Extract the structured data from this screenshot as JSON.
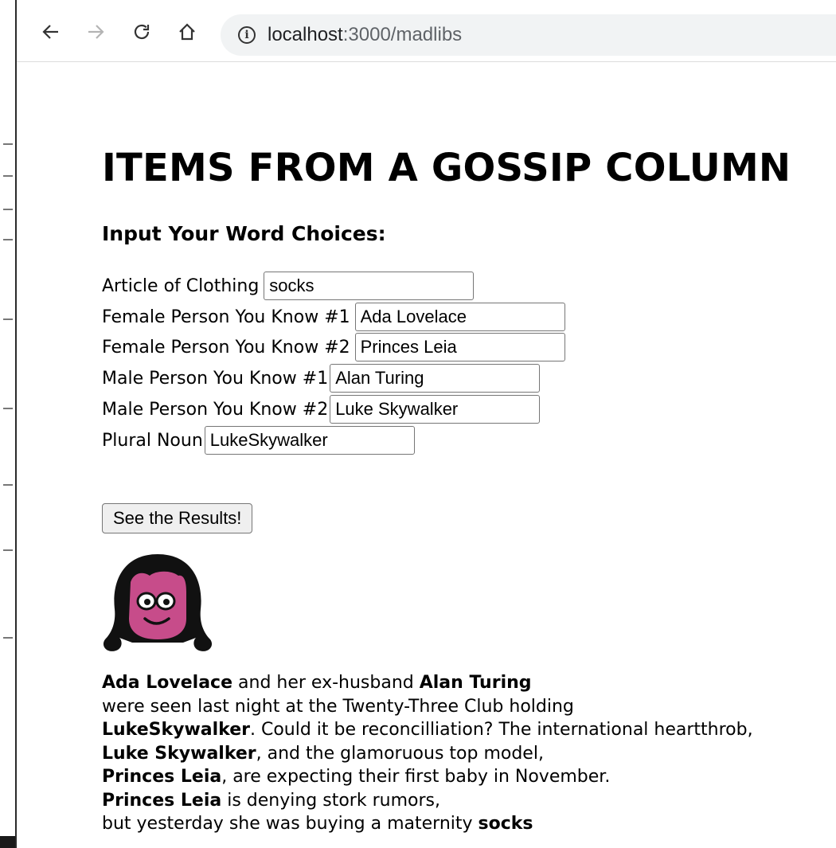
{
  "browser": {
    "url_host": "localhost",
    "url_path": ":3000/madlibs"
  },
  "page": {
    "title": "ITEMS FROM A GOSSIP COLUMN",
    "subtitle": "Input Your Word Choices:"
  },
  "form": {
    "fields": [
      {
        "label": "Article of Clothing",
        "value": "socks"
      },
      {
        "label": "Female Person You Know #1",
        "value": "Ada Lovelace"
      },
      {
        "label": "Female Person You Know #2",
        "value": "Princes Leia"
      },
      {
        "label": "Male Person You Know #1",
        "value": "Alan Turing"
      },
      {
        "label": "Male Person You Know #2",
        "value": "Luke Skywalker"
      },
      {
        "label": "Plural Noun",
        "value": "LukeSkywalker"
      }
    ],
    "submit_label": "See the Results!"
  },
  "avatar": {
    "icon": "cartoon-woman-avatar",
    "face_color": "#c74c8a",
    "hair_color": "#111111"
  },
  "result": {
    "female1": "Ada Lovelace",
    "t1": " and her ex-husband ",
    "male1": "Alan Turing",
    "t2": "were seen last night at the Twenty-Three Club holding",
    "plural_noun": "LukeSkywalker",
    "t3": ". Could it be reconcilliation? The international heartthrob,",
    "male2": "Luke Skywalker",
    "t4": ", and the glamoruous top model,",
    "female2a": "Princes Leia",
    "t5": ", are expecting their first baby in November.",
    "female2b": "Princes Leia",
    "t6": " is denying stork rumors,",
    "t7": "but yesterday she was buying a maternity ",
    "clothing": "socks"
  }
}
